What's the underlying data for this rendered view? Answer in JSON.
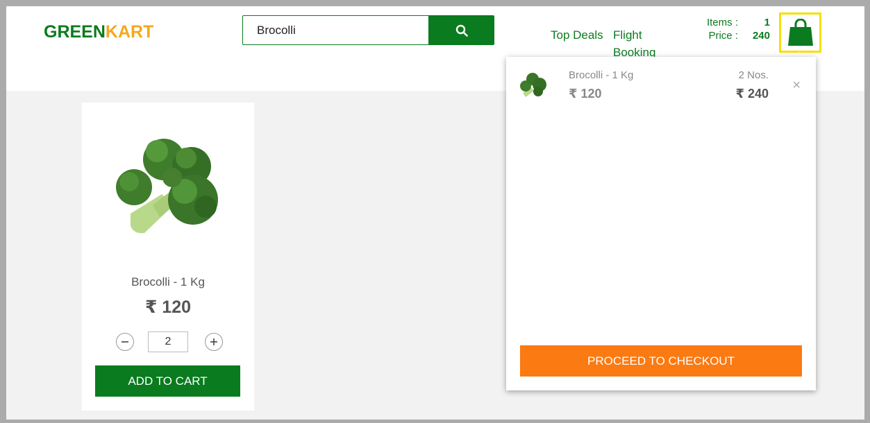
{
  "header": {
    "logo_part1": "GREEN",
    "logo_part2": "KART",
    "search": {
      "value": "Brocolli",
      "placeholder": ""
    },
    "nav": [
      "Top Deals",
      "Flight Booking"
    ],
    "cart_info": {
      "items_label": "Items",
      "items_value": "1",
      "price_label": "Price",
      "price_value": "240",
      "separator": ":"
    }
  },
  "product": {
    "name": "Brocolli - 1 Kg",
    "price": "₹ 120",
    "quantity": "2",
    "add_label": "ADD TO CART"
  },
  "cart_preview": {
    "item": {
      "name": "Brocolli - 1 Kg",
      "price": "₹ 120",
      "qty": "2 Nos.",
      "total": "₹ 240",
      "remove": "×"
    },
    "checkout_label": "PROCEED TO CHECKOUT"
  },
  "colors": {
    "brand_green": "#0a7b1e",
    "brand_orange": "#f5a81c",
    "checkout_orange": "#fb7a12",
    "highlight_yellow": "#f6e000"
  }
}
